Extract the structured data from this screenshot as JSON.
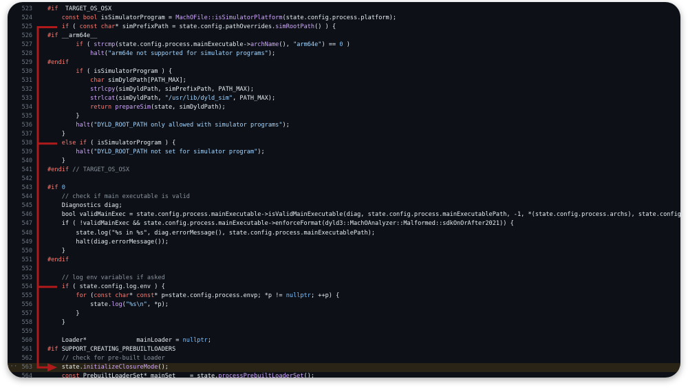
{
  "editor": {
    "fold_marker": "···",
    "highlighted_line": "563",
    "lines": [
      {
        "n": "523",
        "t": [
          [
            "k",
            "#if"
          ],
          [
            "",
            "  TARGET_OS_OSX"
          ]
        ]
      },
      {
        "n": "524",
        "t": [
          [
            "",
            "    "
          ],
          [
            "k",
            "const bool"
          ],
          [
            "",
            " isSimulatorProgram = "
          ],
          [
            "f",
            "MachOFile::isSimulatorPlatform"
          ],
          [
            "",
            "(state.config.process.platform);"
          ]
        ]
      },
      {
        "n": "525",
        "t": [
          [
            "",
            "    "
          ],
          [
            "k",
            "if"
          ],
          [
            "",
            " ( "
          ],
          [
            "k",
            "const char"
          ],
          [
            "",
            "* simPrefixPath = state.config.pathOverrides."
          ],
          [
            "f",
            "simRootPath"
          ],
          [
            "",
            "() ) {"
          ]
        ]
      },
      {
        "n": "526",
        "t": [
          [
            "k",
            "#if"
          ],
          [
            "",
            " __arm64e__"
          ]
        ]
      },
      {
        "n": "527",
        "t": [
          [
            "",
            "        "
          ],
          [
            "k",
            "if"
          ],
          [
            "",
            " ( "
          ],
          [
            "f",
            "strcmp"
          ],
          [
            "",
            "(state.config.process.mainExecutable->"
          ],
          [
            "f",
            "archName"
          ],
          [
            "",
            "(), "
          ],
          [
            "s",
            "\"arm64e\""
          ],
          [
            "",
            ") == "
          ],
          [
            "n",
            "0"
          ],
          [
            "",
            " )"
          ]
        ]
      },
      {
        "n": "528",
        "t": [
          [
            "",
            "            "
          ],
          [
            "f",
            "halt"
          ],
          [
            "",
            "("
          ],
          [
            "s",
            "\"arm64e not supported for simulator programs\""
          ],
          [
            "",
            ");"
          ]
        ]
      },
      {
        "n": "529",
        "t": [
          [
            "k",
            "#endif"
          ]
        ]
      },
      {
        "n": "530",
        "t": [
          [
            "",
            "        "
          ],
          [
            "k",
            "if"
          ],
          [
            "",
            " ( isSimulatorProgram ) {"
          ]
        ]
      },
      {
        "n": "531",
        "t": [
          [
            "",
            "            "
          ],
          [
            "k",
            "char"
          ],
          [
            "",
            " simDyldPath[PATH_MAX];"
          ]
        ]
      },
      {
        "n": "532",
        "t": [
          [
            "",
            "            "
          ],
          [
            "f",
            "strlcpy"
          ],
          [
            "",
            "(simDyldPath, simPrefixPath, PATH_MAX);"
          ]
        ]
      },
      {
        "n": "533",
        "t": [
          [
            "",
            "            "
          ],
          [
            "f",
            "strlcat"
          ],
          [
            "",
            "(simDyldPath, "
          ],
          [
            "s",
            "\"/usr/lib/dyld_sim\""
          ],
          [
            "",
            ", PATH_MAX);"
          ]
        ]
      },
      {
        "n": "534",
        "t": [
          [
            "",
            "            "
          ],
          [
            "k",
            "return"
          ],
          [
            "",
            " "
          ],
          [
            "f",
            "prepareSim"
          ],
          [
            "",
            "(state, simDyldPath);"
          ]
        ]
      },
      {
        "n": "535",
        "t": [
          [
            "",
            "        }"
          ]
        ]
      },
      {
        "n": "536",
        "t": [
          [
            "",
            "        "
          ],
          [
            "f",
            "halt"
          ],
          [
            "",
            "("
          ],
          [
            "s",
            "\"DYLD_ROOT_PATH only allowed with simulator programs\""
          ],
          [
            "",
            ");"
          ]
        ]
      },
      {
        "n": "537",
        "t": [
          [
            "",
            "    }"
          ]
        ]
      },
      {
        "n": "538",
        "t": [
          [
            "",
            "    "
          ],
          [
            "k",
            "else if"
          ],
          [
            "",
            " ( isSimulatorProgram ) {"
          ]
        ]
      },
      {
        "n": "539",
        "t": [
          [
            "",
            "        "
          ],
          [
            "f",
            "halt"
          ],
          [
            "",
            "("
          ],
          [
            "s",
            "\"DYLD_ROOT_PATH not set for simulator program\""
          ],
          [
            "",
            ");"
          ]
        ]
      },
      {
        "n": "540",
        "t": [
          [
            "",
            "    }"
          ]
        ]
      },
      {
        "n": "541",
        "t": [
          [
            "k",
            "#endif"
          ],
          [
            "c",
            " // TARGET_OS_OSX"
          ]
        ]
      },
      {
        "n": "542",
        "t": []
      },
      {
        "n": "543",
        "t": [
          [
            "k",
            "#if"
          ],
          [
            "",
            " "
          ],
          [
            "n",
            "0"
          ]
        ]
      },
      {
        "n": "544",
        "t": [
          [
            "",
            "    "
          ],
          [
            "c",
            "// check if main executable is valid"
          ]
        ]
      },
      {
        "n": "545",
        "t": [
          [
            "",
            "    Diagnostics diag;"
          ]
        ]
      },
      {
        "n": "546",
        "t": [
          [
            "",
            "    bool validMainExec = state.config.process.mainExecutable->isValidMainExecutable(diag, state.config.process.mainExecutablePath, -1, *(state.config.process.archs), state.config.process.platform);"
          ]
        ]
      },
      {
        "n": "547",
        "t": [
          [
            "",
            "    if ( !validMainExec && state.config.process.mainExecutable->enforceFormat(dyld3::MachOAnalyzer::Malformed::sdkOnOrAfter2021)) {"
          ]
        ]
      },
      {
        "n": "548",
        "t": [
          [
            "",
            "        state.log(\"%s in %s\", diag.errorMessage(), state.config.process.mainExecutablePath);"
          ]
        ]
      },
      {
        "n": "549",
        "t": [
          [
            "",
            "        halt(diag.errorMessage());"
          ]
        ]
      },
      {
        "n": "550",
        "t": [
          [
            "",
            "    }"
          ]
        ]
      },
      {
        "n": "551",
        "t": [
          [
            "k",
            "#endif"
          ]
        ]
      },
      {
        "n": "552",
        "t": []
      },
      {
        "n": "553",
        "t": [
          [
            "",
            "    "
          ],
          [
            "c",
            "// log env variables if asked"
          ]
        ]
      },
      {
        "n": "554",
        "t": [
          [
            "",
            "    "
          ],
          [
            "k",
            "if"
          ],
          [
            "",
            " ( state.config.log.env ) {"
          ]
        ]
      },
      {
        "n": "555",
        "t": [
          [
            "",
            "        "
          ],
          [
            "k",
            "for"
          ],
          [
            "",
            " ("
          ],
          [
            "k",
            "const char"
          ],
          [
            "",
            "* "
          ],
          [
            "k",
            "const"
          ],
          [
            "",
            "* p=state.config.process.envp; *p != "
          ],
          [
            "n",
            "nullptr"
          ],
          [
            "",
            "; ++p) {"
          ]
        ]
      },
      {
        "n": "556",
        "t": [
          [
            "",
            "            state."
          ],
          [
            "f",
            "log"
          ],
          [
            "",
            "("
          ],
          [
            "s",
            "\"%s\\n\""
          ],
          [
            "",
            ", *p);"
          ]
        ]
      },
      {
        "n": "557",
        "t": [
          [
            "",
            "        }"
          ]
        ]
      },
      {
        "n": "558",
        "t": [
          [
            "",
            "    }"
          ]
        ]
      },
      {
        "n": "559",
        "t": []
      },
      {
        "n": "560",
        "t": [
          [
            "",
            "    Loader*              mainLoader = "
          ],
          [
            "n",
            "nullptr"
          ],
          [
            "",
            ";"
          ]
        ]
      },
      {
        "n": "561",
        "t": [
          [
            "k",
            "#if"
          ],
          [
            "",
            " SUPPORT_CREATING_PREBUILTLOADERS"
          ]
        ]
      },
      {
        "n": "562",
        "t": [
          [
            "",
            "    "
          ],
          [
            "c",
            "// check for pre-built Loader"
          ]
        ]
      },
      {
        "n": "563",
        "t": [
          [
            "",
            "    state."
          ],
          [
            "f",
            "initializeClosureMode"
          ],
          [
            "",
            "();"
          ]
        ]
      },
      {
        "n": "564",
        "t": [
          [
            "",
            "    "
          ],
          [
            "k",
            "const"
          ],
          [
            "",
            " PrebuiltLoaderSet* mainSet    = state."
          ],
          [
            "f",
            "processPrebuiltLoaderSet"
          ],
          [
            "",
            "();"
          ]
        ]
      }
    ]
  },
  "annotation": {
    "arrow_color": "#b01a1a",
    "targets": [
      "525",
      "538",
      "554",
      "563"
    ]
  }
}
